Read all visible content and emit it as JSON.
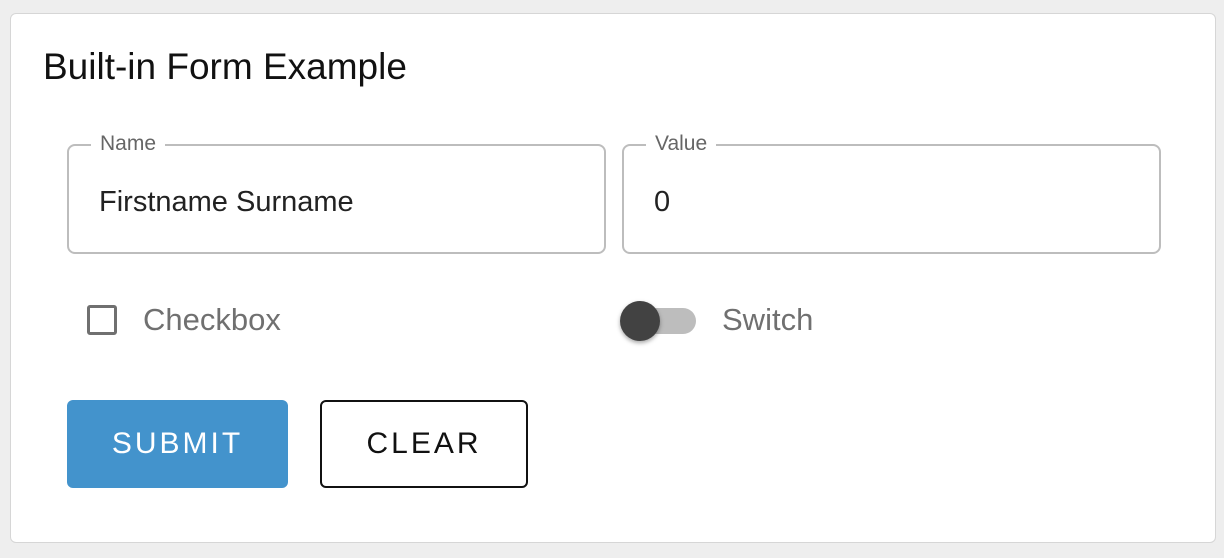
{
  "form": {
    "title": "Built-in Form Example",
    "name_field": {
      "label": "Name",
      "value": "Firstname Surname"
    },
    "value_field": {
      "label": "Value",
      "value": "0"
    },
    "checkbox": {
      "label": "Checkbox",
      "checked": false
    },
    "switch": {
      "label": "Switch",
      "on": false
    },
    "submit_label": "SUBMIT",
    "clear_label": "CLEAR"
  },
  "colors": {
    "primary": "#4393cc",
    "background": "#eeeeee",
    "card": "#ffffff",
    "switch_thumb": "#424242",
    "switch_track": "#bdbdbd"
  }
}
